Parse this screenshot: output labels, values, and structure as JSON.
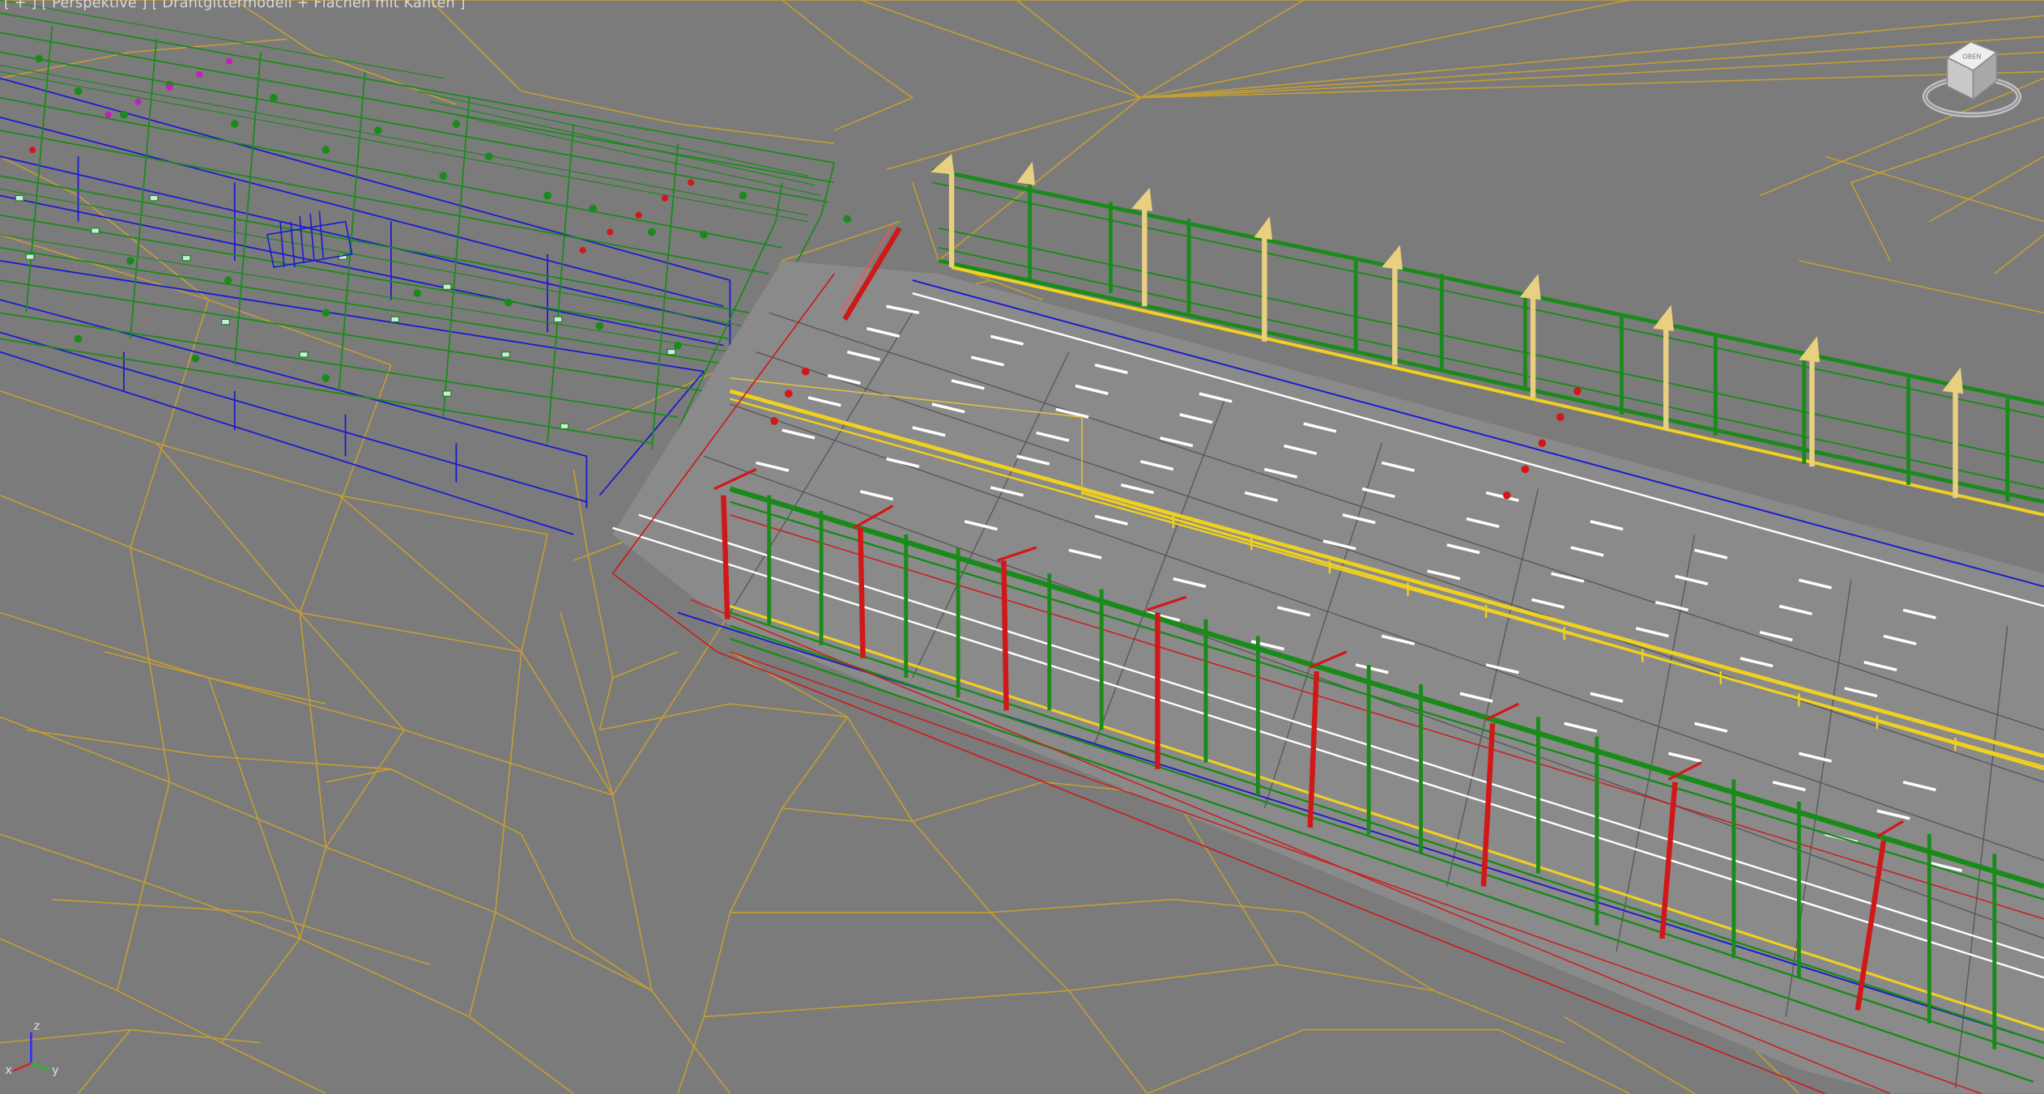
{
  "viewport": {
    "labels": {
      "menu": "[ + ]",
      "view": "[ Perspektive ]",
      "shading": "[ Drahtgittermodell + Flächen mit Kanten ]"
    },
    "viewcube": {
      "face_label": "OBEN"
    },
    "axes": {
      "x": "x",
      "y": "y",
      "z": "z"
    }
  },
  "colors": {
    "background": "#7b7b7b",
    "terrain_wire": "#c8a030",
    "structure_green": "#1a8a1a",
    "structure_blue": "#1a1ad0",
    "frame_red": "#d01818",
    "barrier_yellow": "#f0d020",
    "post_beige": "#e8d080",
    "lane_marking": "#ffffff"
  }
}
